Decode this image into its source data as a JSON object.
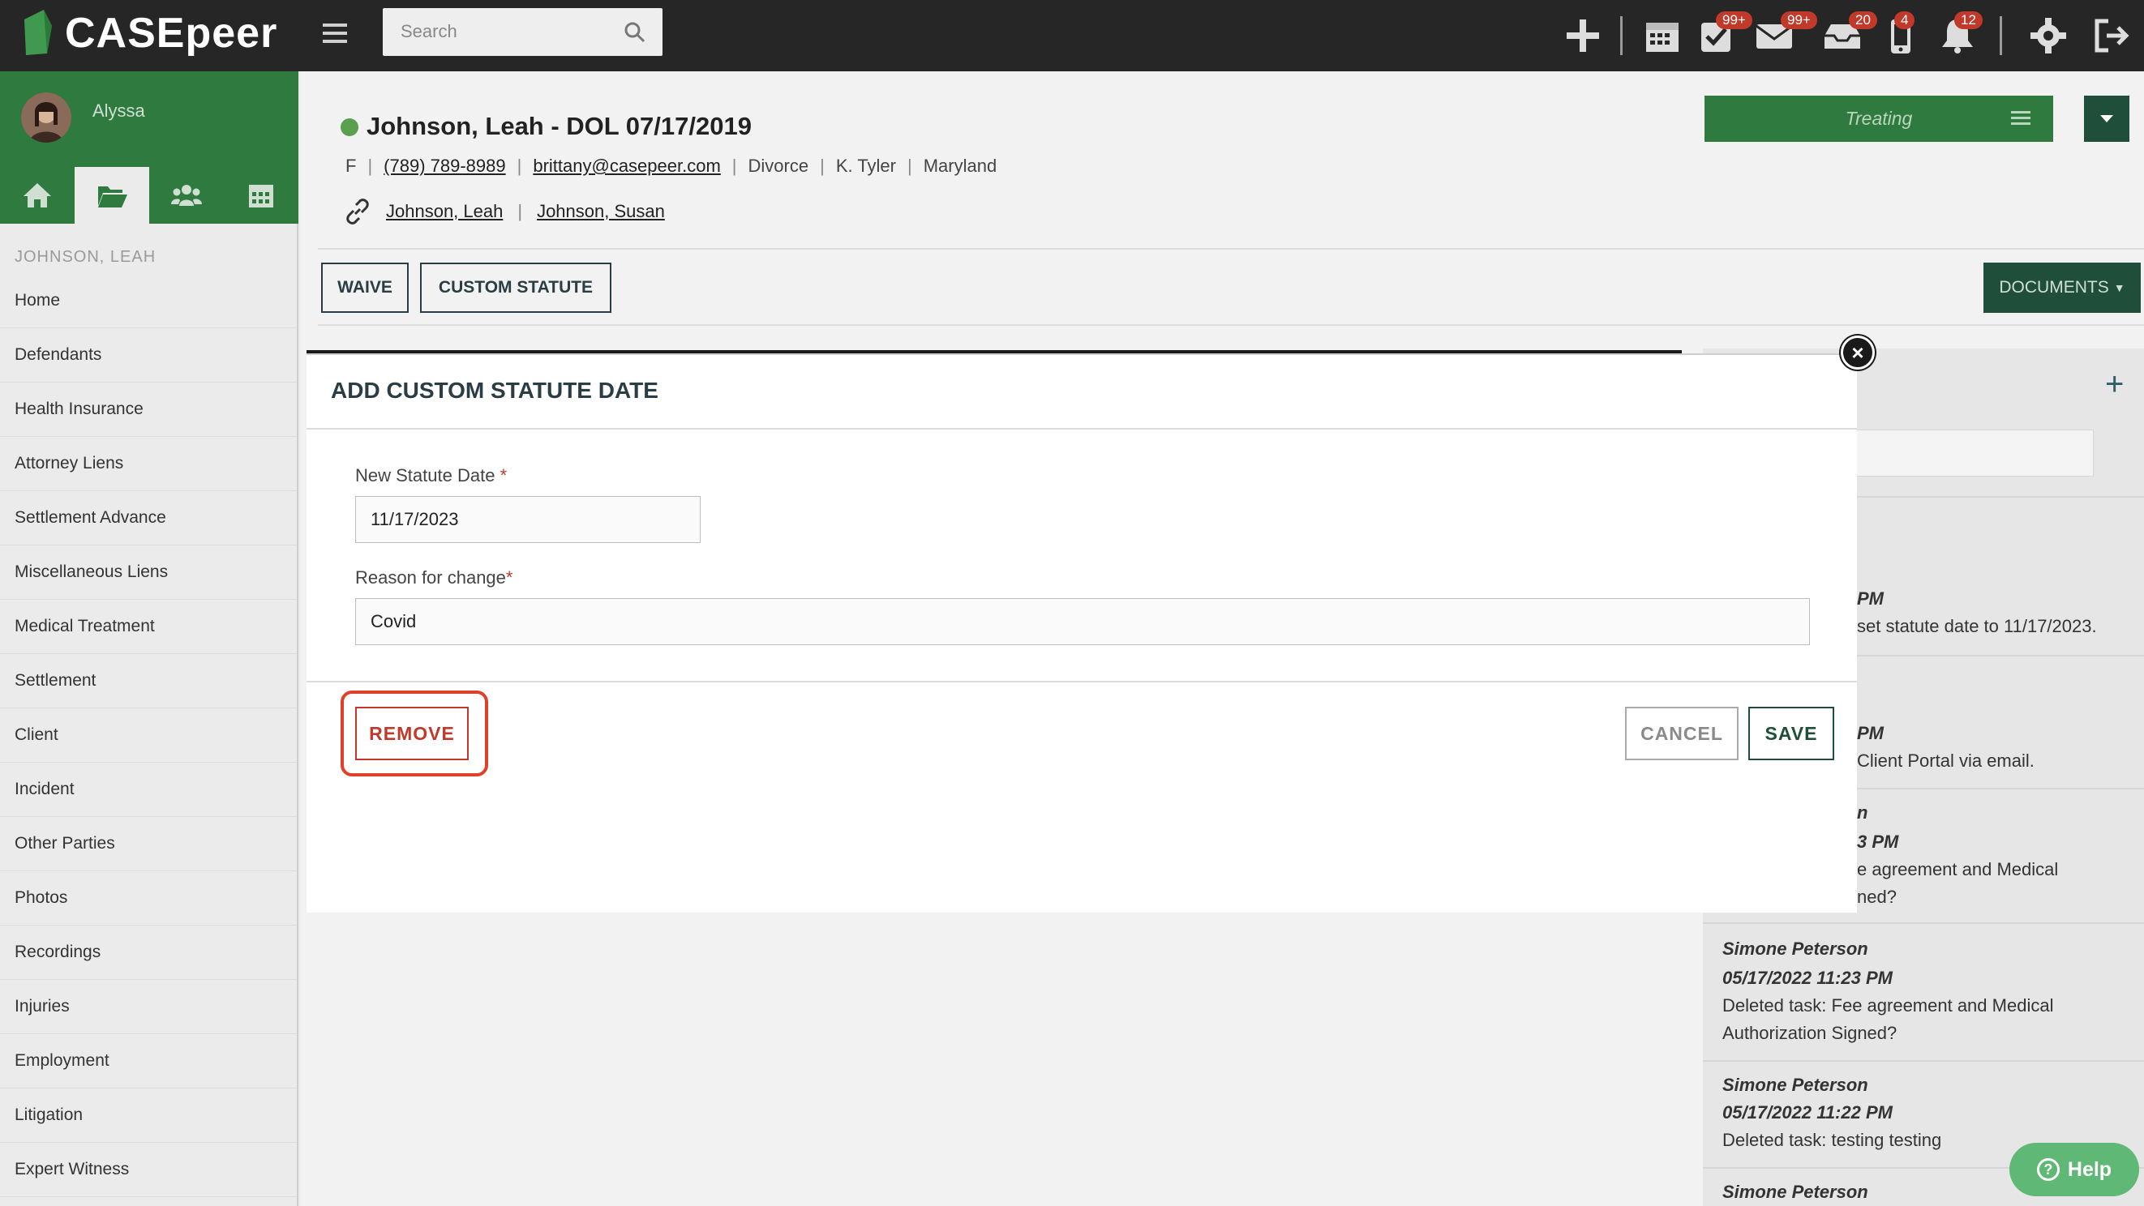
{
  "app": {
    "logo_text": "CASEpeer",
    "search_placeholder": "Search",
    "badges": {
      "tasks": "99+",
      "mail": "99+",
      "inbox": "20",
      "phone": "4",
      "notifications": "12"
    }
  },
  "sidebar": {
    "user_name": "Alyssa",
    "case_name": "JOHNSON, LEAH",
    "items": [
      "Home",
      "Defendants",
      "Health Insurance",
      "Attorney Liens",
      "Settlement Advance",
      "Miscellaneous Liens",
      "Medical Treatment",
      "Settlement",
      "Client",
      "Incident",
      "Other Parties",
      "Photos",
      "Recordings",
      "Injuries",
      "Employment",
      "Litigation",
      "Expert Witness"
    ]
  },
  "case": {
    "title": "Johnson, Leah - DOL 07/17/2019",
    "gender": "F",
    "phone": "(789) 789-8989",
    "email": "brittany@casepeer.com",
    "type": "Divorce",
    "attorney": "K. Tyler",
    "state": "Maryland",
    "linked": [
      "Johnson, Leah",
      "Johnson, Susan"
    ],
    "status": "Treating",
    "colors": {
      "status_dot": "#5aa04e",
      "brand_green": "#2f7a3f"
    }
  },
  "actions": {
    "waive": "WAIVE",
    "custom_statute": "CUSTOM STATUTE",
    "documents": "DOCUMENTS"
  },
  "activity": {
    "entries": [
      {
        "time_partial": "PM",
        "text_partial": "set statute date to 11/17/2023."
      },
      {
        "time_partial": "PM",
        "text_partial": "Client Portal via email."
      },
      {
        "name_partial": "n",
        "time_partial": "3 PM",
        "text1_partial": "e agreement and Medical",
        "text2_partial": "ned?"
      },
      {
        "name": "Simone Peterson",
        "time": "05/17/2022 11:23 PM",
        "text1": "Deleted task: Fee agreement and Medical",
        "text2": "Authorization Signed?"
      },
      {
        "name": "Simone Peterson",
        "time": "05/17/2022 11:22 PM",
        "text1": "Deleted task: testing testing"
      },
      {
        "name": "Simone Peterson"
      }
    ]
  },
  "modal": {
    "title": "ADD CUSTOM STATUTE DATE",
    "date_label": "New Statute Date",
    "date_required": "*",
    "date_value": "11/17/2023",
    "reason_label": "Reason for change",
    "reason_required": "*",
    "reason_value": "Covid",
    "remove": "REMOVE",
    "cancel": "CANCEL",
    "save": "SAVE",
    "close": "×"
  },
  "help": {
    "label": "Help",
    "icon": "?"
  }
}
